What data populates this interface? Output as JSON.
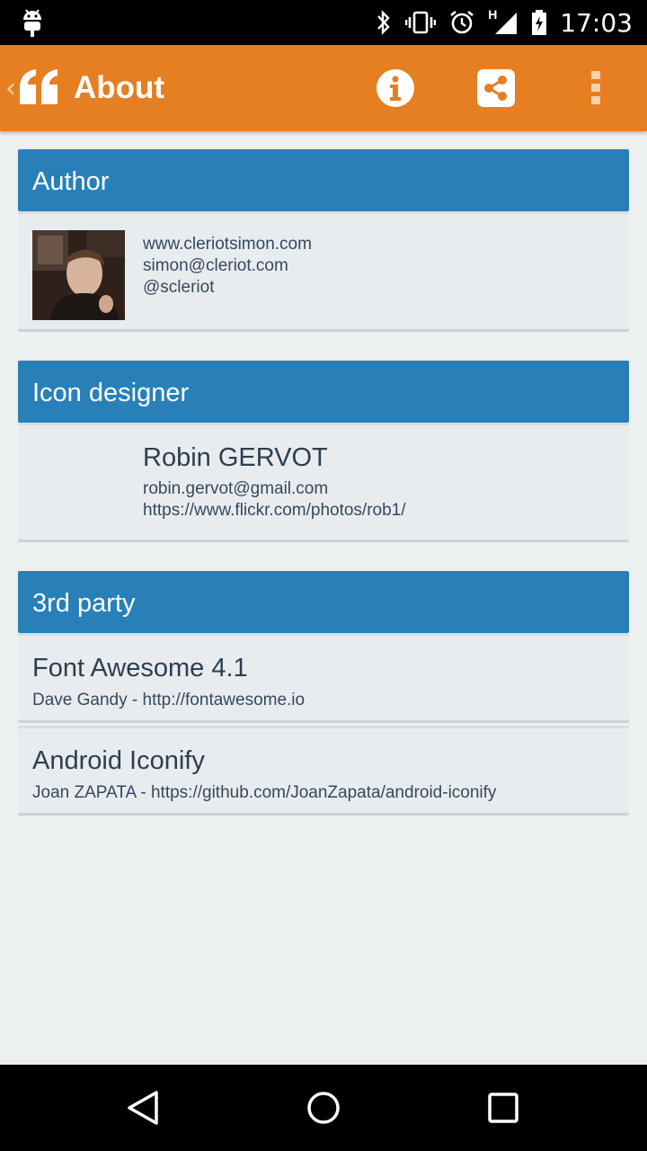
{
  "status_bar": {
    "time": "17:03",
    "network_label": "H",
    "icons": [
      "android-debug-icon",
      "bluetooth-icon",
      "vibrate-icon",
      "alarm-icon",
      "signal-icon",
      "battery-charging-icon"
    ]
  },
  "action_bar": {
    "title": "About",
    "app_icon": "quote-left-icon",
    "actions": [
      "info-icon",
      "share-icon",
      "overflow-menu-icon"
    ],
    "color": "#e67e22"
  },
  "sections": {
    "author": {
      "header": "Author",
      "website": "www.cleriotsimon.com",
      "email": "simon@cleriot.com",
      "twitter": "@scleriot"
    },
    "icon_designer": {
      "header": "Icon designer",
      "name": "Robin GERVOT",
      "email": "robin.gervot@gmail.com",
      "url": "https://www.flickr.com/photos/rob1/"
    },
    "third_party": {
      "header": "3rd party",
      "items": [
        {
          "name": "Font Awesome 4.1",
          "desc": "Dave Gandy - http://fontawesome.io"
        },
        {
          "name": "Android Iconify",
          "desc": "Joan ZAPATA - https://github.com/JoanZapata/android-iconify"
        }
      ]
    }
  },
  "colors": {
    "header_blue": "#2980b9",
    "background": "#ecf0f1",
    "card": "#e9ecee"
  },
  "nav_bar": {
    "buttons": [
      "back-icon",
      "home-icon",
      "recents-icon"
    ]
  }
}
